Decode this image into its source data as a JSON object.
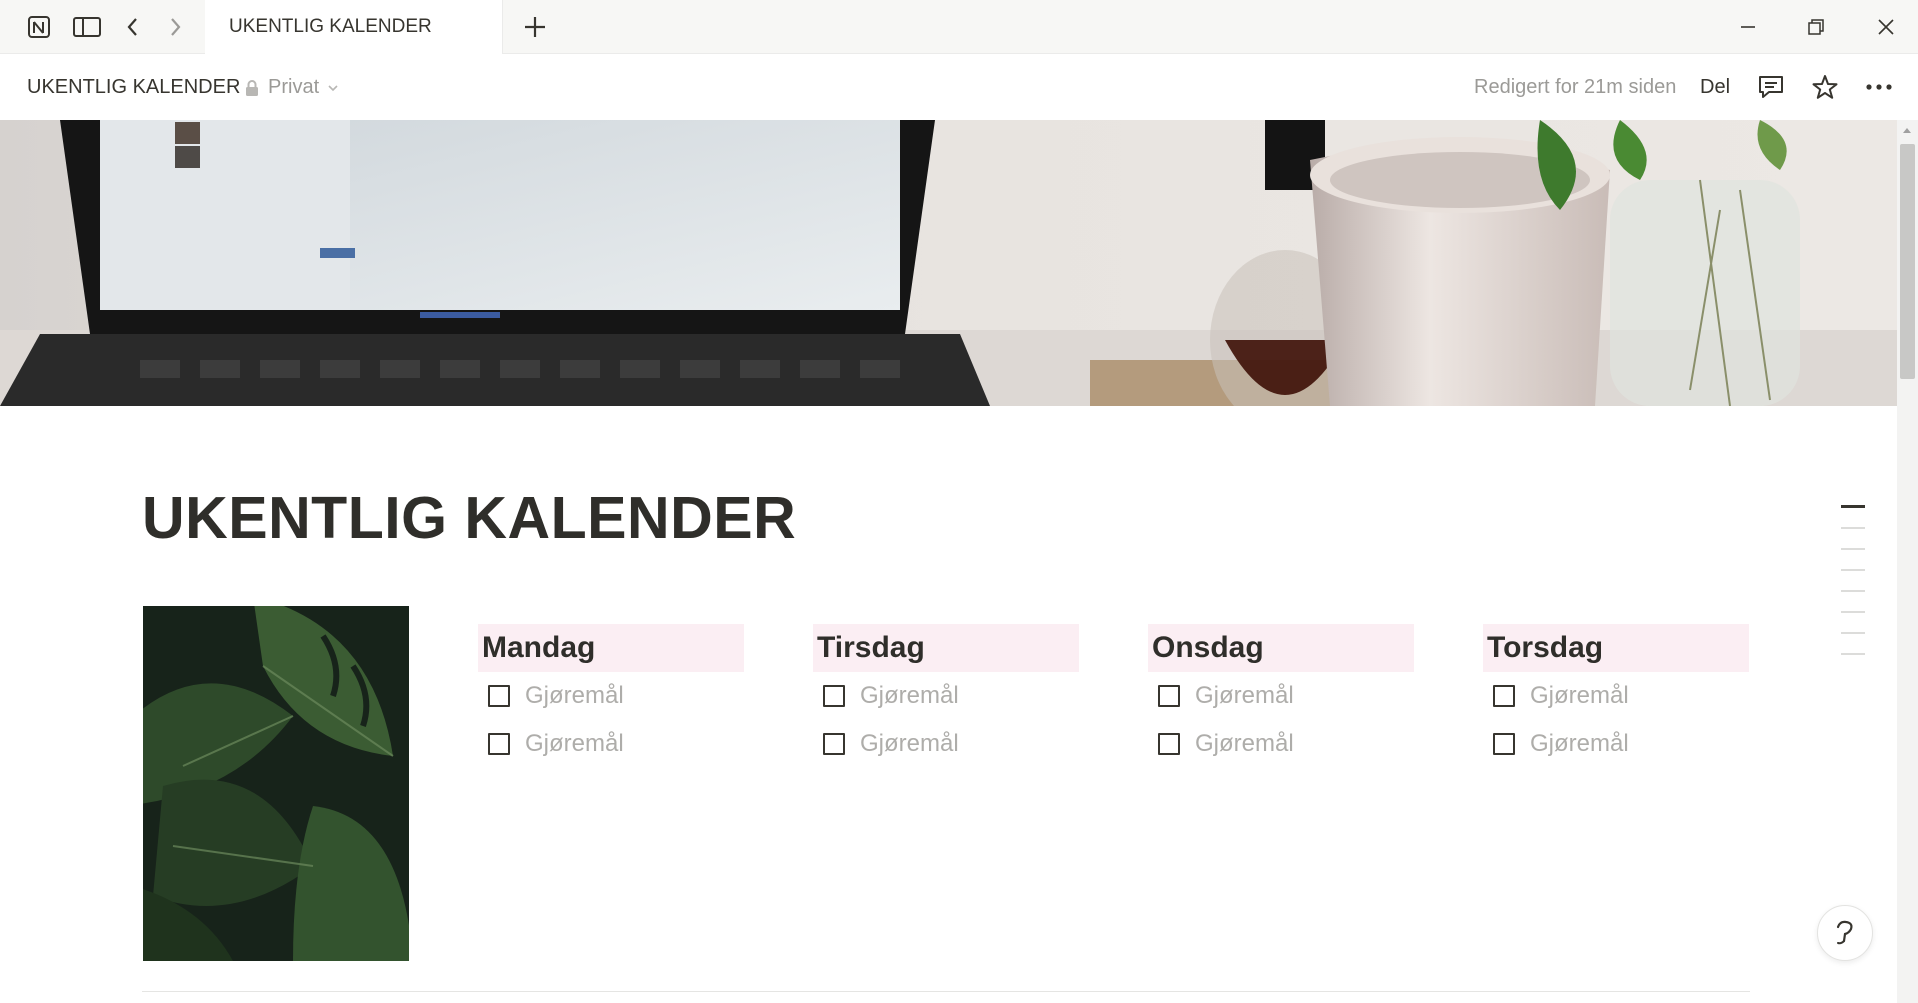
{
  "titlebar": {
    "tab_title": "UKENTLIG KALENDER",
    "icons": [
      "notion-logo-icon",
      "sidebar-toggle-icon",
      "back-arrow-icon",
      "forward-arrow-icon",
      "new-tab-plus-icon",
      "minimize-icon",
      "restore-icon",
      "close-icon"
    ]
  },
  "topbar": {
    "breadcrumb": "UKENTLIG KALENDER",
    "privacy_label": "Privat",
    "edited_label": "Redigert for 21m siden",
    "share_label": "Del"
  },
  "page": {
    "title": "UKENTLIG KALENDER",
    "days": [
      {
        "name": "Mandag",
        "todos": [
          "Gjøremål",
          "Gjøremål"
        ]
      },
      {
        "name": "Tirsdag",
        "todos": [
          "Gjøremål",
          "Gjøremål"
        ]
      },
      {
        "name": "Onsdag",
        "todos": [
          "Gjøremål",
          "Gjøremål"
        ]
      },
      {
        "name": "Torsdag",
        "todos": [
          "Gjøremål",
          "Gjøremål"
        ]
      }
    ]
  },
  "colors": {
    "day_header_bg": "#fbeef3",
    "placeholder_text": "#aeadaa",
    "text": "#37352f"
  }
}
